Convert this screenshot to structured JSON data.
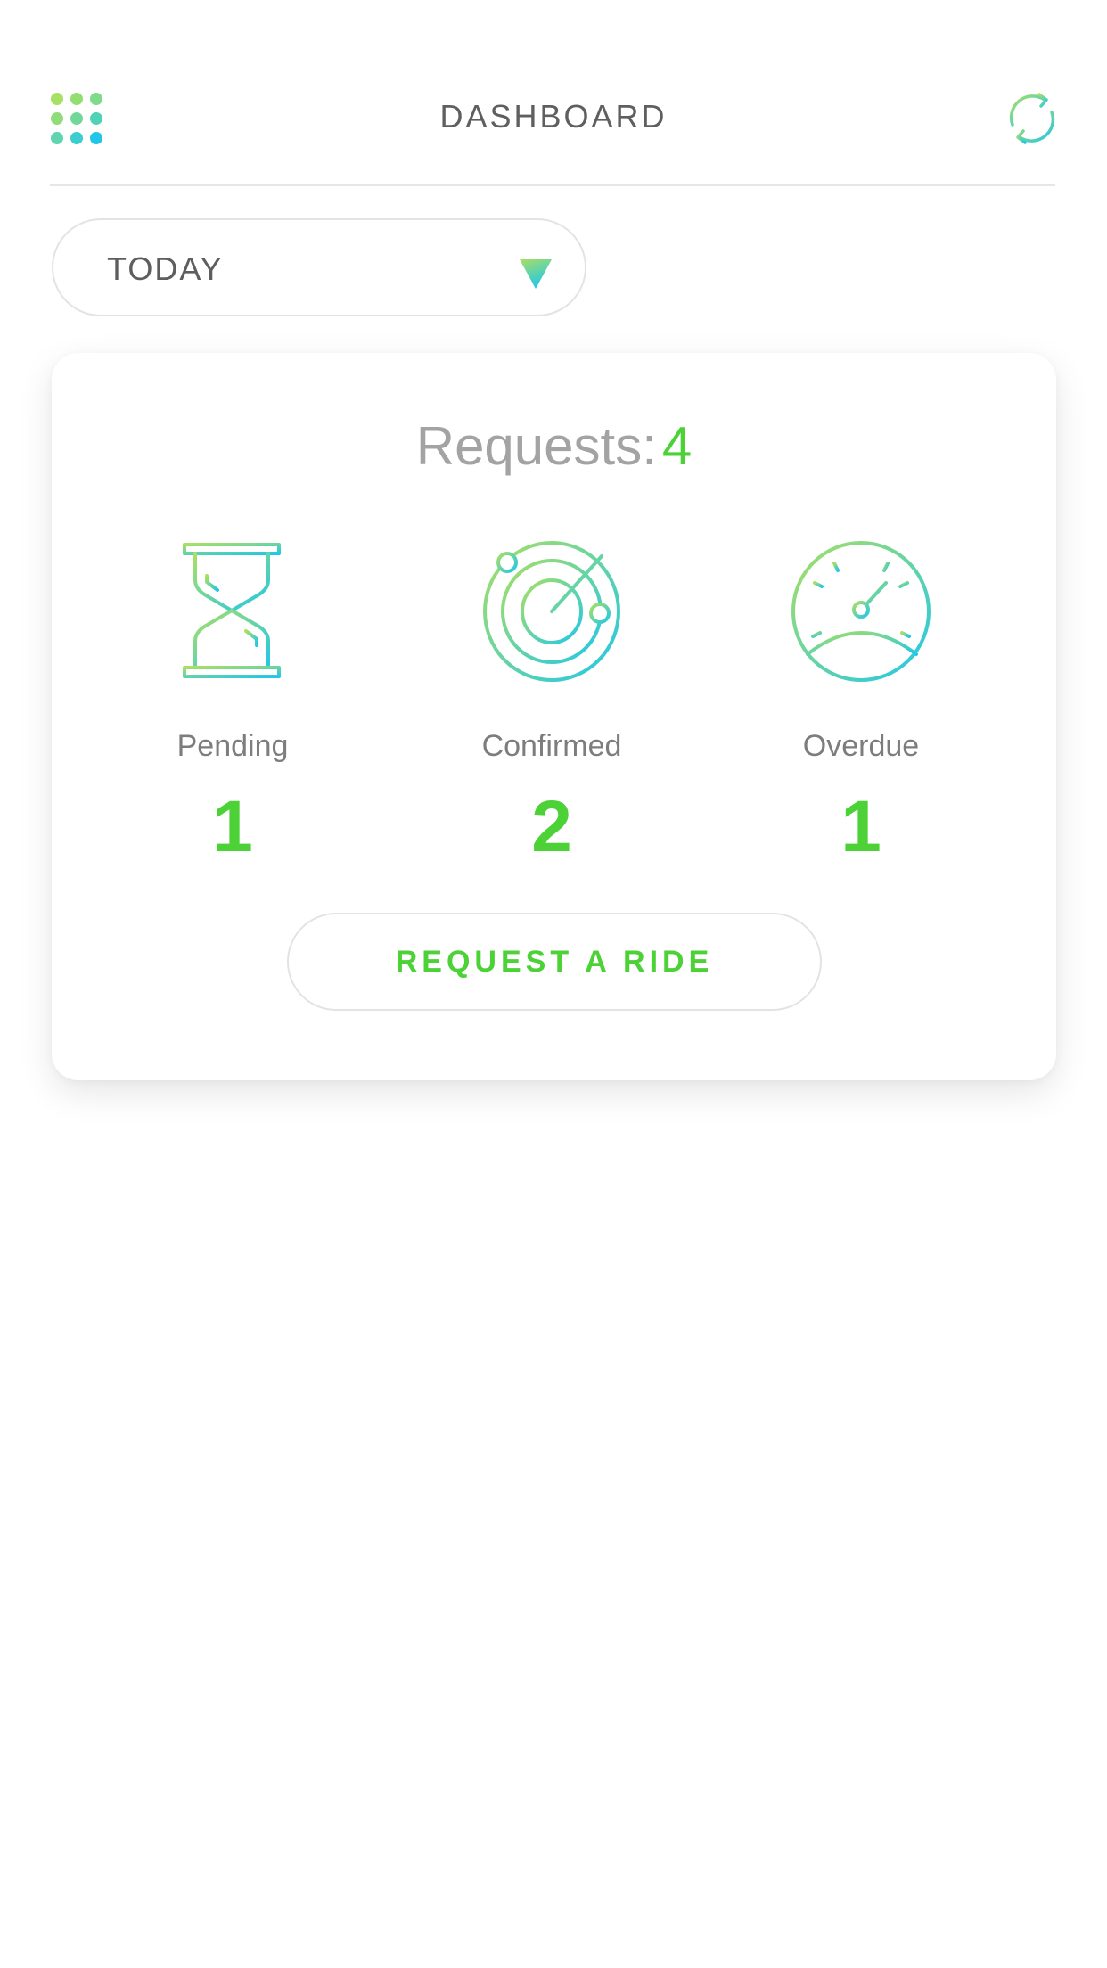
{
  "header": {
    "title": "DASHBOARD",
    "menu_icon": "grid-dots-icon",
    "refresh_icon": "refresh-icon"
  },
  "filter": {
    "selected": "TODAY",
    "arrow_icon": "triangle-down-icon"
  },
  "summary": {
    "requests_label": "Requests:",
    "requests_count": "4",
    "stats": [
      {
        "label": "Pending",
        "value": "1",
        "icon": "hourglass-icon"
      },
      {
        "label": "Confirmed",
        "value": "2",
        "icon": "radar-icon"
      },
      {
        "label": "Overdue",
        "value": "1",
        "icon": "speedometer-icon"
      }
    ],
    "cta_label": "REQUEST A RIDE"
  },
  "colors": {
    "accent_green": "#4cd137",
    "gradient_start": "#a8e063",
    "gradient_end": "#22c7e8",
    "text_gray": "#5f5f5f",
    "muted_gray": "#a3a3a3"
  }
}
